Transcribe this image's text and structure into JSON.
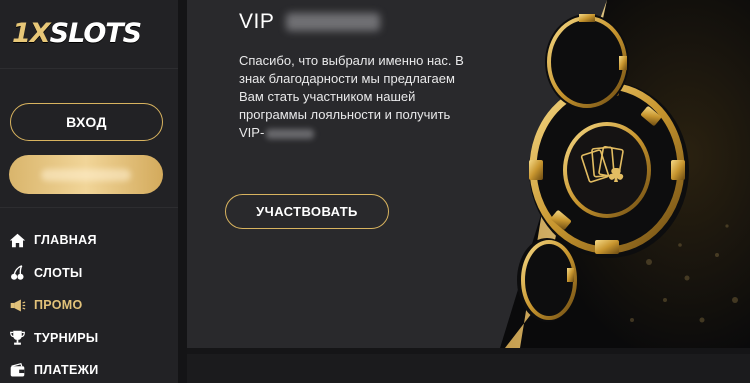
{
  "brand": {
    "logo_one": "1",
    "logo_x": "X",
    "logo_rest": "SLOTS"
  },
  "auth": {
    "login_label": "ВХОД"
  },
  "nav": {
    "items": [
      {
        "label": "ГЛАВНАЯ",
        "icon": "home-icon"
      },
      {
        "label": "СЛОТЫ",
        "icon": "cherry-icon"
      },
      {
        "label": "ПРОМО",
        "icon": "megaphone-icon",
        "active": true
      },
      {
        "label": "ТУРНИРЫ",
        "icon": "trophy-icon"
      },
      {
        "label": "ПЛАТЕЖИ",
        "icon": "wallet-icon"
      }
    ]
  },
  "promo": {
    "title": "VIP",
    "description": "Спасибо, что выбрали именно нас. В знак благодарности мы предлагаем Вам стать участником нашей программы лояльности и получить VIP-",
    "cta_label": "УЧАСТВОВАТЬ"
  },
  "colors": {
    "accent_gold": "#d8b35f",
    "active_nav": "#e2c27a",
    "sidebar_bg": "#222225",
    "banner_bg": "#29292c"
  }
}
